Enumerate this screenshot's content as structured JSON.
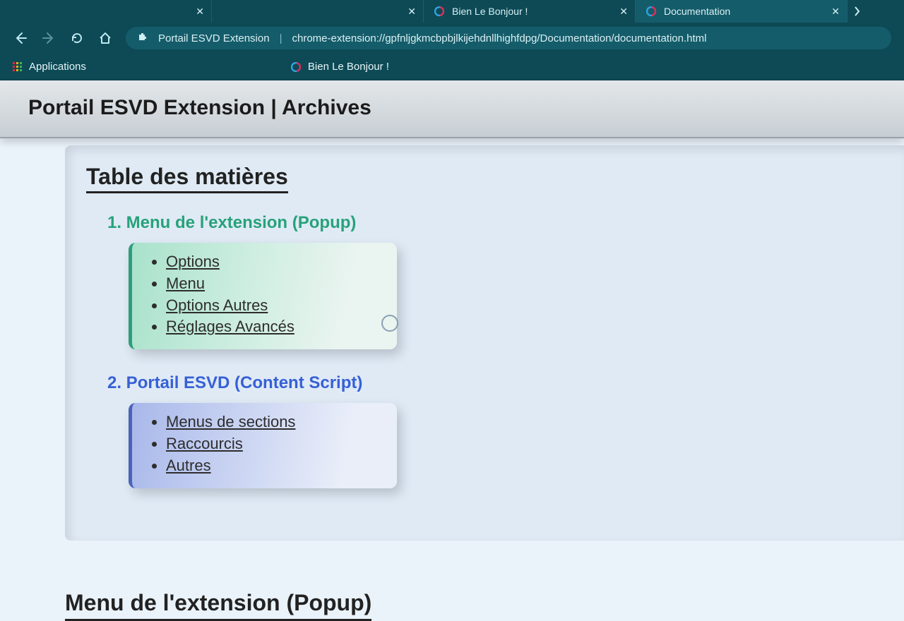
{
  "browser": {
    "tabs": [
      {
        "title": "",
        "active": false,
        "favicon": null
      },
      {
        "title": "",
        "active": false,
        "favicon": null
      },
      {
        "title": "Bien Le Bonjour !",
        "active": false,
        "favicon": "ext"
      },
      {
        "title": "Documentation",
        "active": true,
        "favicon": "ext"
      }
    ],
    "address": {
      "label": "Portail ESVD Extension",
      "url": "chrome-extension://gpfnljgkmcbpbjlkijehdnllhighfdpg/Documentation/documentation.html"
    },
    "bookmarks": [
      {
        "label": "Applications",
        "icon": "apps"
      },
      {
        "label": "Bien Le Bonjour !",
        "icon": "ext"
      }
    ]
  },
  "page": {
    "banner_title": "Portail ESVD Extension | Archives",
    "toc_title": "Table des matières",
    "sections": [
      {
        "title": "1. Menu de l'extension (Popup)",
        "color": "green",
        "items": [
          "Options",
          "Menu",
          "Options Autres",
          "Réglages Avancés"
        ]
      },
      {
        "title": "2. Portail ESVD (Content Script)",
        "color": "blue",
        "items": [
          "Menus de sections",
          "Raccourcis",
          "Autres"
        ]
      }
    ],
    "next_heading": "Menu de l'extension (Popup)"
  }
}
